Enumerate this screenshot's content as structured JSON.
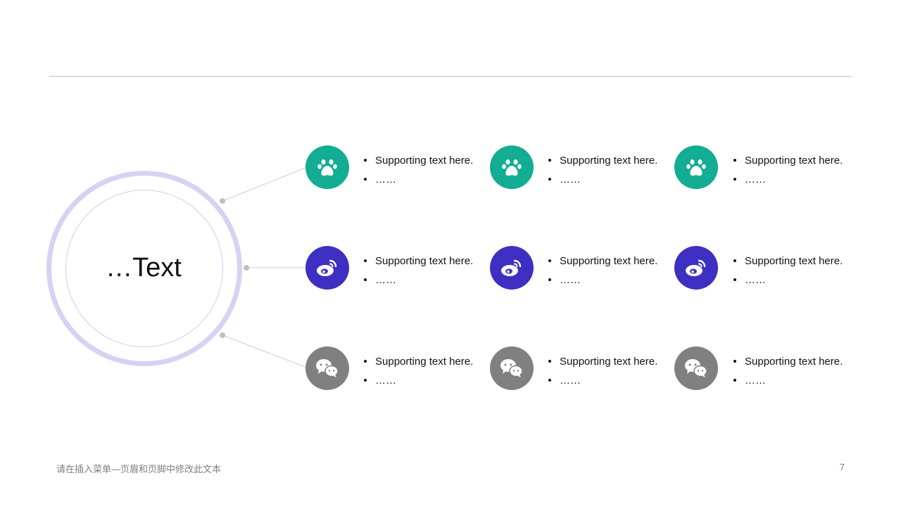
{
  "center": {
    "title": "…Text"
  },
  "colors": {
    "teal": "#12ad93",
    "indigo": "#3d2fc2",
    "gray": "#808080",
    "ring": "#d6d2f4"
  },
  "rows": [
    {
      "icon": "paw-icon",
      "color": "#12ad93",
      "items": [
        {
          "line1": "Supporting text here.",
          "line2": "……"
        },
        {
          "line1": "Supporting text here.",
          "line2": "……"
        },
        {
          "line1": "Supporting text here.",
          "line2": "……"
        }
      ]
    },
    {
      "icon": "weibo-icon",
      "color": "#3d2fc2",
      "items": [
        {
          "line1": "Supporting text here.",
          "line2": "……"
        },
        {
          "line1": "Supporting text here.",
          "line2": "……"
        },
        {
          "line1": "Supporting text here.",
          "line2": "……"
        }
      ]
    },
    {
      "icon": "wechat-icon",
      "color": "#808080",
      "items": [
        {
          "line1": "Supporting text here.",
          "line2": "……"
        },
        {
          "line1": "Supporting text here.",
          "line2": "……"
        },
        {
          "line1": "Supporting text here.",
          "line2": "……"
        }
      ]
    }
  ],
  "footer": {
    "text": "请在插入菜单—页眉和页脚中修改此文本",
    "page_number": "7"
  }
}
